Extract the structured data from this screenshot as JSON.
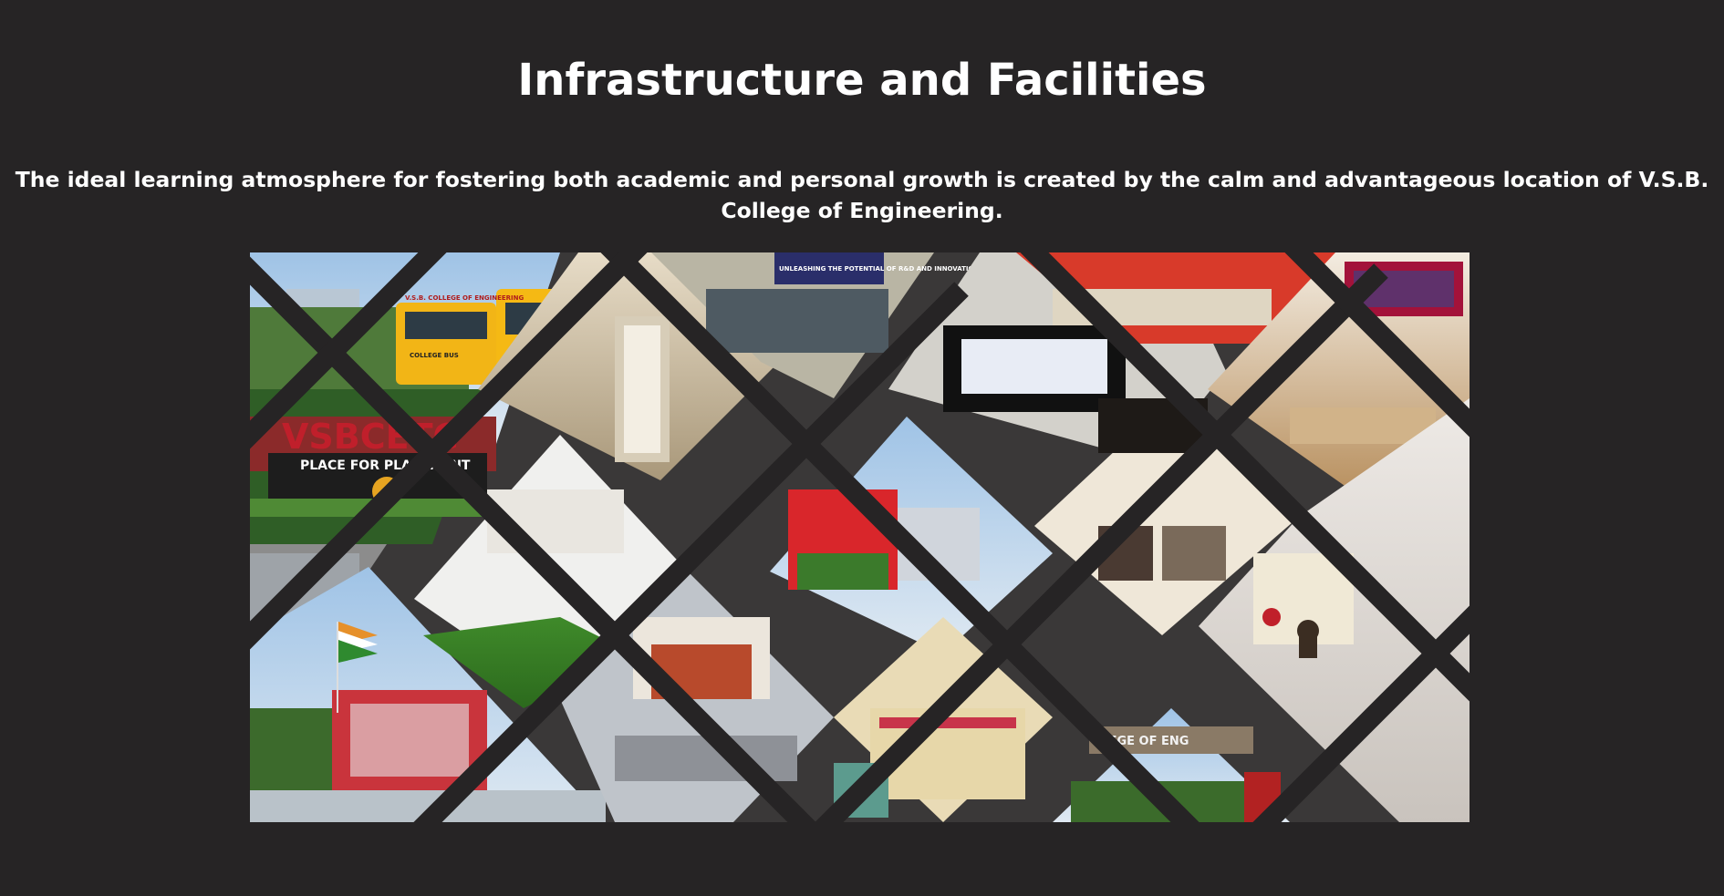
{
  "section": {
    "title": "Infrastructure and Facilities",
    "description": "The ideal learning atmosphere for fostering both academic and personal growth is created by the calm and advantageous location of V.S.B. College of Engineering."
  },
  "collage": {
    "sign_main": "VSBCETC",
    "sign_tagline": "PLACE FOR PLACEMENT",
    "bus_header": "V.S.B. COLLEGE OF ENGINEERING",
    "bus_label": "COLLEGE BUS",
    "banner_text": "UNLEASHING THE POTENTIAL OF R&D AND INNOVATION",
    "gate_text": "LLEGE OF ENG"
  }
}
